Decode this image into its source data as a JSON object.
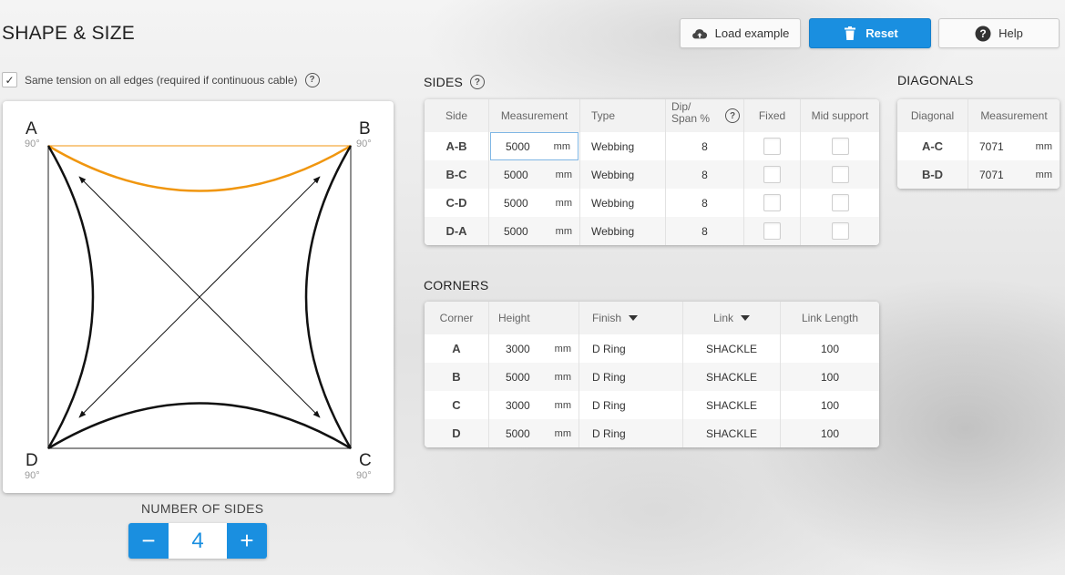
{
  "page_title": "SHAPE & SIZE",
  "toolbar": {
    "load_example": "Load example",
    "reset": "Reset",
    "help": "Help"
  },
  "tension": {
    "checked": true,
    "check_glyph": "✓",
    "label": "Same tension on all edges (required if continuous cable)",
    "help_glyph": "?"
  },
  "shape": {
    "corners": [
      {
        "letter": "A",
        "angle": "90°"
      },
      {
        "letter": "B",
        "angle": "90°"
      },
      {
        "letter": "C",
        "angle": "90°"
      },
      {
        "letter": "D",
        "angle": "90°"
      }
    ],
    "selected_edge": "A-B",
    "highlight_color": "#f0960f",
    "edge_color": "#111111"
  },
  "number_of_sides": {
    "label": "NUMBER OF SIDES",
    "value": "4",
    "minus": "−",
    "plus": "+"
  },
  "sides": {
    "title": "SIDES",
    "help_glyph": "?",
    "headers": {
      "side": "Side",
      "measurement": "Measurement",
      "type": "Type",
      "dip_span_line1": "Dip/",
      "dip_span_line2": "Span %",
      "dip_help": "?",
      "fixed": "Fixed",
      "mid_support": "Mid support"
    },
    "rows": [
      {
        "side": "A-B",
        "measurement": "5000",
        "unit": "mm",
        "type": "Webbing",
        "dip": "8"
      },
      {
        "side": "B-C",
        "measurement": "5000",
        "unit": "mm",
        "type": "Webbing",
        "dip": "8"
      },
      {
        "side": "C-D",
        "measurement": "5000",
        "unit": "mm",
        "type": "Webbing",
        "dip": "8"
      },
      {
        "side": "D-A",
        "measurement": "5000",
        "unit": "mm",
        "type": "Webbing",
        "dip": "8"
      }
    ]
  },
  "diagonals": {
    "title": "DIAGONALS",
    "headers": {
      "diagonal": "Diagonal",
      "measurement": "Measurement"
    },
    "rows": [
      {
        "diagonal": "A-C",
        "measurement": "7071",
        "unit": "mm"
      },
      {
        "diagonal": "B-D",
        "measurement": "7071",
        "unit": "mm"
      }
    ]
  },
  "corners_table": {
    "title": "CORNERS",
    "headers": {
      "corner": "Corner",
      "height": "Height",
      "finish": "Finish",
      "link": "Link",
      "link_length": "Link Length"
    },
    "rows": [
      {
        "corner": "A",
        "height": "3000",
        "unit": "mm",
        "finish": "D Ring",
        "link": "SHACKLE",
        "link_length": "100"
      },
      {
        "corner": "B",
        "height": "5000",
        "unit": "mm",
        "finish": "D Ring",
        "link": "SHACKLE",
        "link_length": "100"
      },
      {
        "corner": "C",
        "height": "3000",
        "unit": "mm",
        "finish": "D Ring",
        "link": "SHACKLE",
        "link_length": "100"
      },
      {
        "corner": "D",
        "height": "5000",
        "unit": "mm",
        "finish": "D Ring",
        "link": "SHACKLE",
        "link_length": "100"
      }
    ]
  }
}
